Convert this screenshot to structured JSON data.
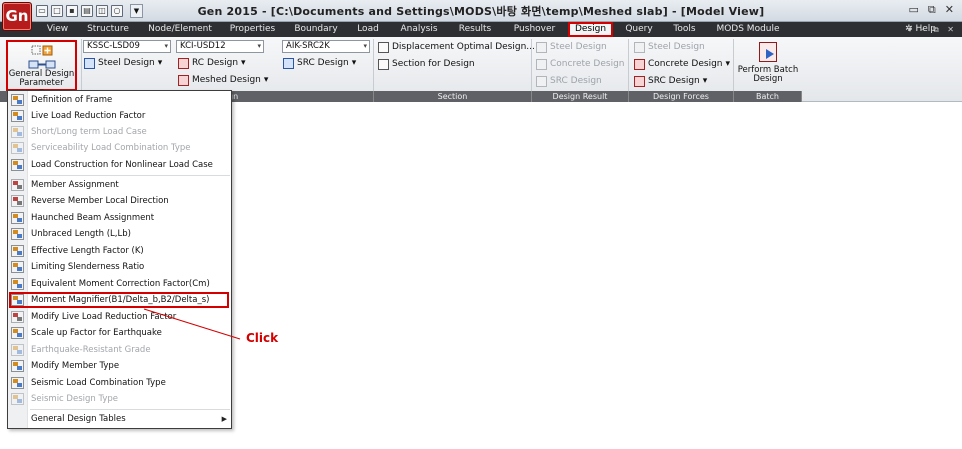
{
  "window": {
    "app_icon_text": "Gn",
    "title": "Gen 2015 - [C:\\Documents and Settings\\MODS\\바탕 화면\\temp\\Meshed slab] - [Model View]",
    "controls": [
      "▭",
      "⧉",
      "✕"
    ]
  },
  "menu_tabs": [
    {
      "label": "View",
      "active": false
    },
    {
      "label": "Structure",
      "active": false
    },
    {
      "label": "Node/Element",
      "active": false
    },
    {
      "label": "Properties",
      "active": false
    },
    {
      "label": "Boundary",
      "active": false
    },
    {
      "label": "Load",
      "active": false
    },
    {
      "label": "Analysis",
      "active": false
    },
    {
      "label": "Results",
      "active": false
    },
    {
      "label": "Pushover",
      "active": false
    },
    {
      "label": "Design",
      "active": true
    },
    {
      "label": "Query",
      "active": false
    },
    {
      "label": "Tools",
      "active": false
    },
    {
      "label": "MODS Module",
      "active": false
    }
  ],
  "help_label": "Help",
  "ribbon": {
    "general_design_parameter": "General Design Parameter",
    "combos": {
      "steel_code": "KSSC-LSD09",
      "rc_code": "KCI-USD12",
      "src_code": "AIK-SRC2K"
    },
    "buttons": {
      "steel_design": "Steel Design",
      "rc_design": "RC Design",
      "meshed_design": "Meshed Design",
      "src_design": "SRC Design",
      "displacement_optimal": "Displacement Optimal Design...",
      "section_for_design": "Section for Design",
      "result_steel": "Steel Design",
      "result_concrete": "Concrete Design",
      "result_src": "SRC Design",
      "forces_steel": "Steel Design",
      "forces_concrete": "Concrete Design",
      "forces_src": "SRC Design",
      "perform_batch": "Perform Batch Design"
    },
    "groups": {
      "design_partial": "gn",
      "section": "Section",
      "design_result": "Design Result",
      "design_forces": "Design Forces",
      "batch": "Batch"
    }
  },
  "dropdown": {
    "items": [
      {
        "label": "Definition of Frame",
        "disabled": false
      },
      {
        "label": "Live Load Reduction Factor",
        "disabled": false
      },
      {
        "label": "Short/Long term Load Case",
        "disabled": true
      },
      {
        "label": "Serviceability Load Combination Type",
        "disabled": true
      },
      {
        "label": "Load Construction for Nonlinear Load Case",
        "disabled": false
      },
      {
        "label": "Member Assignment",
        "disabled": false
      },
      {
        "label": "Reverse Member Local Direction",
        "disabled": false
      },
      {
        "label": "Haunched Beam Assignment",
        "disabled": false
      },
      {
        "label": "Unbraced Length (L,Lb)",
        "disabled": false
      },
      {
        "label": "Effective Length Factor (K)",
        "disabled": false
      },
      {
        "label": "Limiting Slenderness Ratio",
        "disabled": false
      },
      {
        "label": "Equivalent Moment Correction Factor(Cm)",
        "disabled": false
      },
      {
        "label": "Moment Magnifier(B1/Delta_b,B2/Delta_s)",
        "disabled": false
      },
      {
        "label": "Modify Live Load Reduction Factor",
        "disabled": false
      },
      {
        "label": "Scale up Factor for Earthquake",
        "disabled": false
      },
      {
        "label": "Earthquake-Resistant Grade",
        "disabled": true
      },
      {
        "label": "Modify Member Type",
        "disabled": false
      },
      {
        "label": "Seismic Load Combination Type",
        "disabled": false
      },
      {
        "label": "Seismic Design Type",
        "disabled": true
      },
      {
        "label": "General Design Tables",
        "disabled": false
      }
    ]
  },
  "annotation": {
    "callout_text": "Click",
    "color": "#d40000"
  }
}
